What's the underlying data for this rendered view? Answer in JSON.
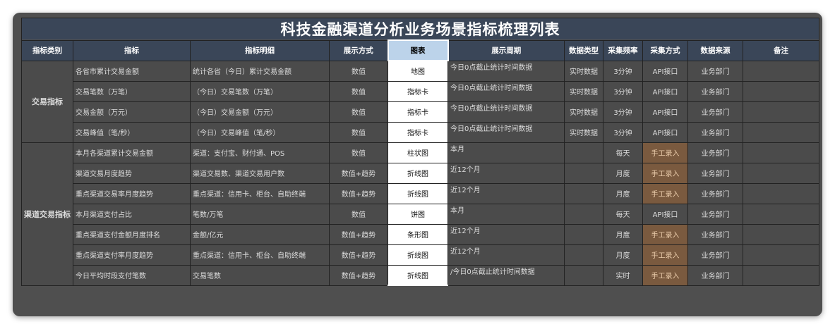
{
  "title": "科技金融渠道分析业务场景指标梳理列表",
  "headers": [
    "指标类别",
    "指标",
    "指标明细",
    "展示方式",
    "图表",
    "展示周期",
    "数据类型",
    "采集频率",
    "采集方式",
    "数据来源",
    "备注"
  ],
  "categories": [
    {
      "name": "交易指标",
      "rows": [
        {
          "metric": "各省市累计交易金额",
          "detail": "统计各省（今日）累计交易金额",
          "display": "数值",
          "chart": "地图",
          "period": "今日0点截止统计时间数据",
          "dtype": "实时数据",
          "freq": "3分钟",
          "method": "API接口",
          "source": "业务部门",
          "note": "",
          "manual": false
        },
        {
          "metric": "交易笔数（万笔）",
          "detail": "（今日）交易笔数（万笔）",
          "display": "数值",
          "chart": "指标卡",
          "period": "今日0点截止统计时间数据",
          "dtype": "实时数据",
          "freq": "3分钟",
          "method": "API接口",
          "source": "业务部门",
          "note": "",
          "manual": false
        },
        {
          "metric": "交易金额（万元）",
          "detail": "（今日）交易金额（万元）",
          "display": "数值",
          "chart": "指标卡",
          "period": "今日0点截止统计时间数据",
          "dtype": "实时数据",
          "freq": "3分钟",
          "method": "API接口",
          "source": "业务部门",
          "note": "",
          "manual": false
        },
        {
          "metric": "交易峰值（笔/秒）",
          "detail": "（今日）交易峰值（笔/秒）",
          "display": "数值",
          "chart": "指标卡",
          "period": "今日0点截止统计时间数据",
          "dtype": "实时数据",
          "freq": "3分钟",
          "method": "API接口",
          "source": "业务部门",
          "note": "",
          "manual": false
        }
      ]
    },
    {
      "name": "渠道交易指标",
      "rows": [
        {
          "metric": "本月各渠道累计交易金额",
          "detail": "渠道：支付宝、财付通、POS",
          "display": "数值",
          "chart": "柱状图",
          "period": "本月",
          "dtype": "",
          "freq": "每天",
          "method": "手工录入",
          "source": "业务部门",
          "note": "",
          "manual": true
        },
        {
          "metric": "渠道交易月度趋势",
          "detail": "渠道交易数、渠道交易用户数",
          "display": "数值+趋势",
          "chart": "折线图",
          "period": "近12个月",
          "dtype": "",
          "freq": "月度",
          "method": "手工录入",
          "source": "业务部门",
          "note": "",
          "manual": true
        },
        {
          "metric": "重点渠道交易率月度趋势",
          "detail": "重点渠道：信用卡、柜台、自助终端",
          "display": "数值+趋势",
          "chart": "折线图",
          "period": "近12个月",
          "dtype": "",
          "freq": "月度",
          "method": "手工录入",
          "source": "业务部门",
          "note": "",
          "manual": true
        },
        {
          "metric": "本月渠道支付占比",
          "detail": "笔数/万笔",
          "display": "数值",
          "chart": "饼图",
          "period": "本月",
          "dtype": "",
          "freq": "每天",
          "method": "API接口",
          "source": "业务部门",
          "note": "",
          "manual": false
        },
        {
          "metric": "重点渠道支付金额月度排名",
          "detail": "金额/亿元",
          "display": "数值+趋势",
          "chart": "条形图",
          "period": "近12个月",
          "dtype": "",
          "freq": "月度",
          "method": "手工录入",
          "source": "业务部门",
          "note": "",
          "manual": true
        },
        {
          "metric": "重点渠道支付率月度趋势",
          "detail": "重点渠道：信用卡、柜台、自助终端",
          "display": "数值+趋势",
          "chart": "折线图",
          "period": "近12个月",
          "dtype": "",
          "freq": "月度",
          "method": "手工录入",
          "source": "业务部门",
          "note": "",
          "manual": true
        },
        {
          "metric": "今日平均时段支付笔数",
          "detail": "交易笔数",
          "display": "数值+趋势",
          "chart": "折线图",
          "period": "/今日0点截止统计时间数据",
          "dtype": "",
          "freq": "实时",
          "method": "手工录入",
          "source": "业务部门",
          "note": "",
          "manual": true
        }
      ]
    }
  ],
  "colors": {
    "frame": "#4f4f4f",
    "header_bg": "#3a4658",
    "highlight_header": "#bcd3ea",
    "manual_fill": "#7a5a3f",
    "chart_column": "#ffffff"
  }
}
